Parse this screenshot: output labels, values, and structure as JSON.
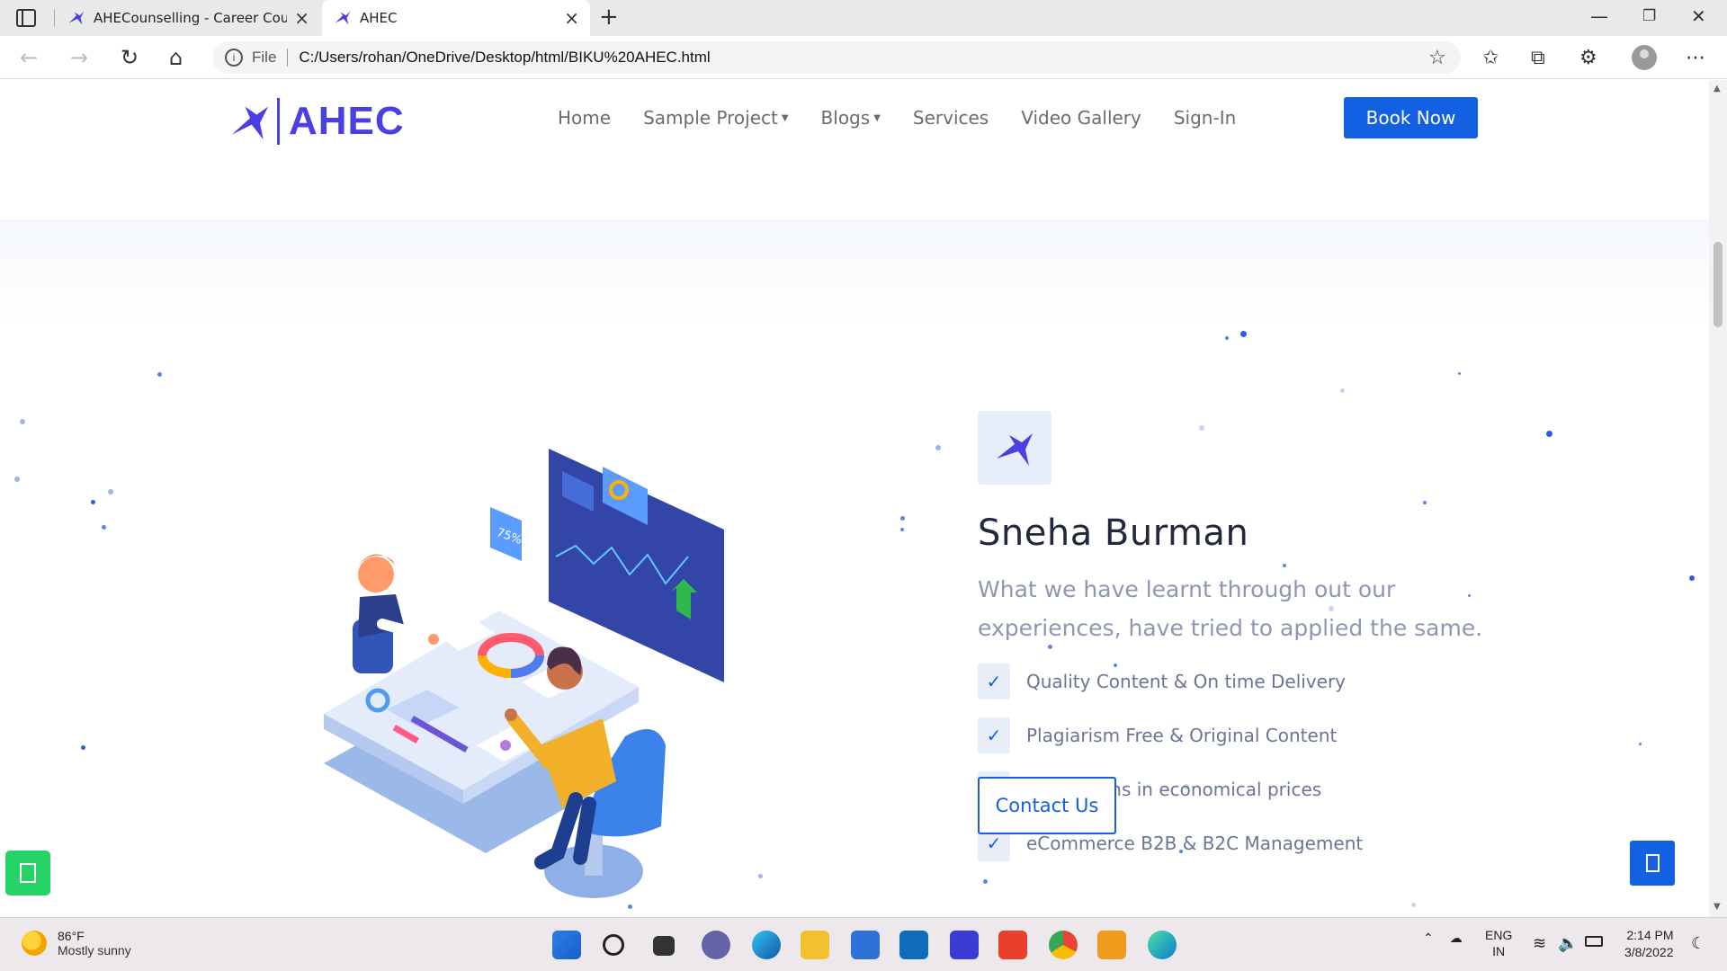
{
  "browser": {
    "tabs": [
      {
        "title": "AHECounselling - Career Counse",
        "active": false
      },
      {
        "title": "AHEC",
        "active": true
      }
    ],
    "address": {
      "file_label": "File",
      "url": "C:/Users/rohan/OneDrive/Desktop/html/BIKU%20AHEC.html"
    }
  },
  "site": {
    "logo_text": "AHEC",
    "nav": [
      {
        "label": "Home",
        "dropdown": false
      },
      {
        "label": "Sample Project",
        "dropdown": true
      },
      {
        "label": "Blogs",
        "dropdown": true
      },
      {
        "label": "Services",
        "dropdown": false
      },
      {
        "label": "Video Gallery",
        "dropdown": false
      },
      {
        "label": "Sign-In",
        "dropdown": false
      }
    ],
    "book_now": "Book Now",
    "accent_color": "#1360e2",
    "brand_color": "#4a3fe0"
  },
  "hero": {
    "name": "Sneha Burman",
    "tagline": "What we have learnt through out our experiences, have tried to applied the same.",
    "features": [
      "Quality Content & On time Delivery",
      "Plagiarism Free & Original Content",
      "IT Solutions in economical prices",
      "eCommerce B2B & B2C Management"
    ],
    "contact_button": "Contact Us",
    "chart_badge": "75%"
  },
  "taskbar": {
    "weather": {
      "temp": "86°F",
      "desc": "Mostly sunny"
    },
    "lang": {
      "line1": "ENG",
      "line2": "IN"
    },
    "clock": {
      "time": "2:14 PM",
      "date": "3/8/2022"
    }
  }
}
